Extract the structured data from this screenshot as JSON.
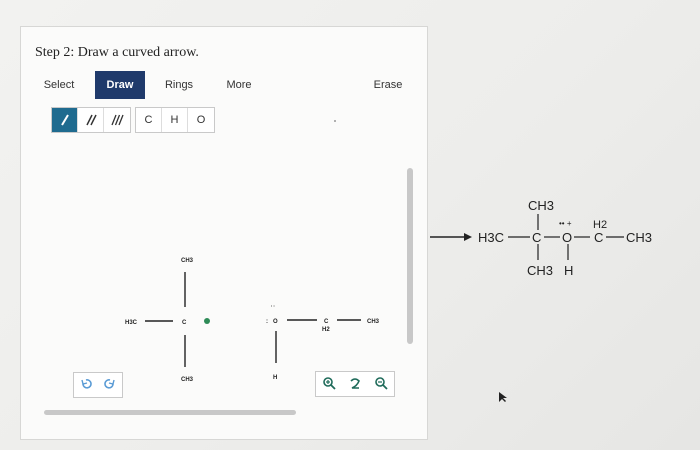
{
  "step_title": "Step 2: Draw a curved arrow.",
  "tabs": [
    {
      "label": "Select"
    },
    {
      "label": "Draw"
    },
    {
      "label": "Rings"
    },
    {
      "label": "More"
    },
    {
      "label": "Erase"
    }
  ],
  "bond_tools": [
    "single-bond-icon",
    "double-bond-icon",
    "triple-bond-icon"
  ],
  "atom_tools": [
    "C",
    "H",
    "O"
  ],
  "canvas": {
    "left_molecule": {
      "top_group": "CH3",
      "left_group": "H3C",
      "center_atom": "C",
      "bottom_group": "CH3",
      "charge": "+"
    },
    "right_molecule": {
      "oxygen": "O",
      "lone_pair": ":",
      "carbon": "C",
      "carbon_h": "H2",
      "right_group": "CH3",
      "bottom_h": "H"
    }
  },
  "reference_product": {
    "top_ch3": "CH3",
    "left_h3c": "H3C",
    "c1": "C",
    "o": "O",
    "lone_pairs_charge": "•• +",
    "h2": "H2",
    "c2": "C",
    "ch3_right": "CH3",
    "bottom_ch3": "CH3",
    "bottom_h": "H"
  },
  "colors": {
    "accent": "#1f3a6b",
    "bond_tool_active": "#1f6b8f",
    "zoom_icon": "#1f6b5a",
    "charge_dot": "#2e8b57"
  }
}
